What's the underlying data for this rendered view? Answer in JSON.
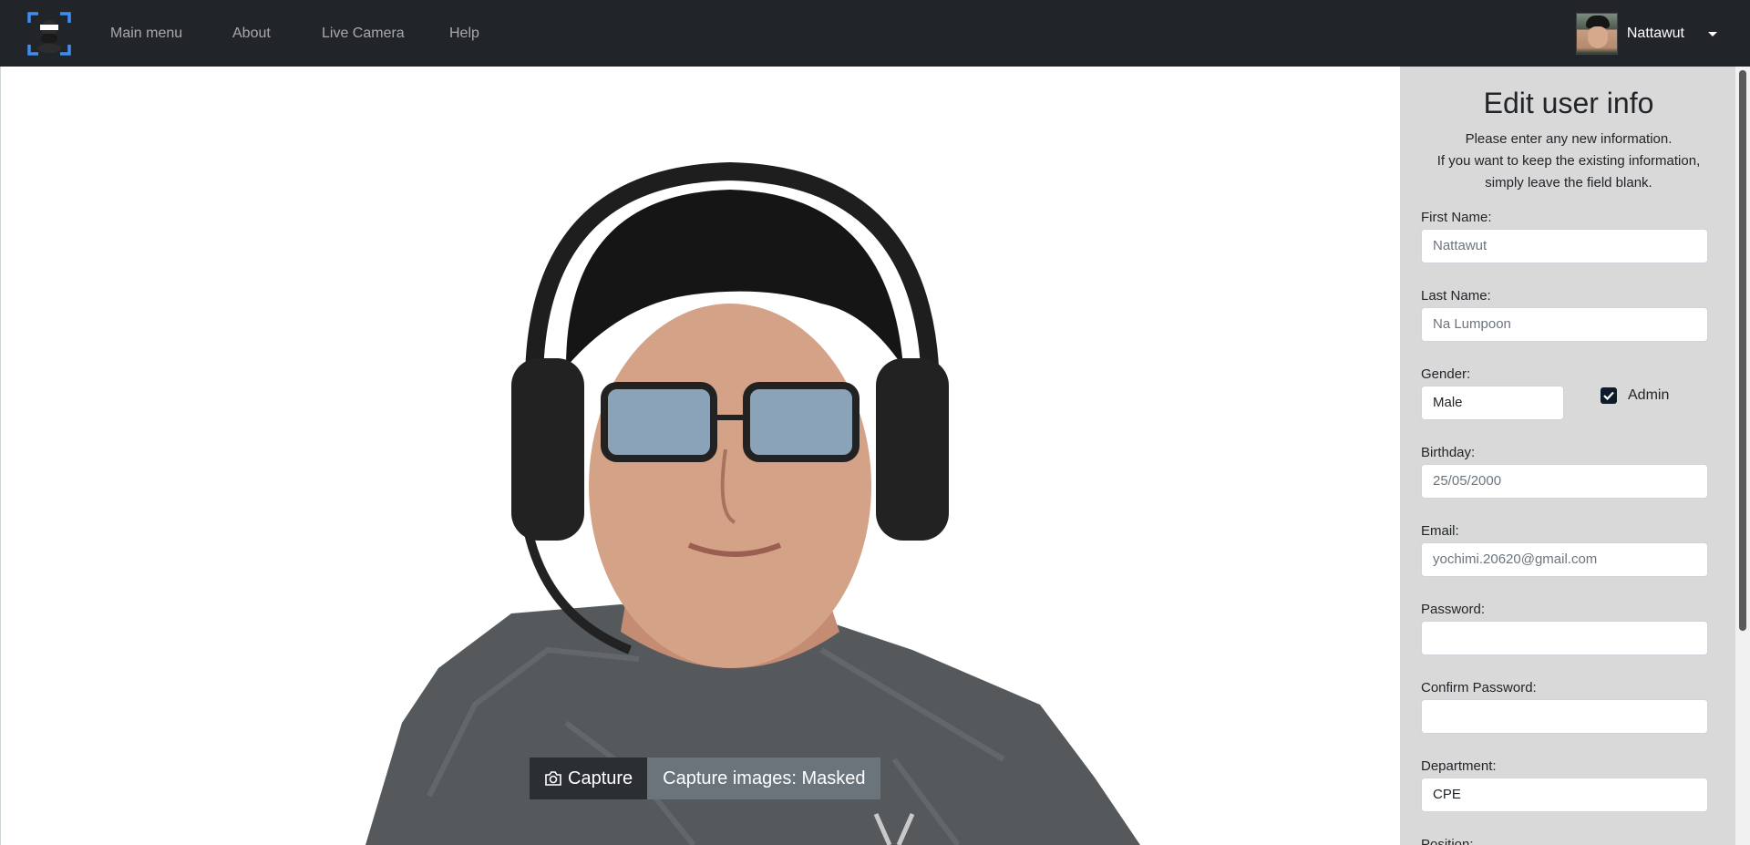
{
  "nav": {
    "links": [
      "Main menu",
      "About",
      "Live Camera",
      "Help"
    ],
    "username": "Nattawut"
  },
  "camera": {
    "capture_label": "Capture",
    "mode_label": "Capture images: Masked"
  },
  "form": {
    "title": "Edit user info",
    "description": [
      "Please enter any new information.",
      "If you want to keep the existing information,",
      "simply leave the field blank."
    ],
    "first_name": {
      "label": "First Name:",
      "placeholder": "Nattawut"
    },
    "last_name": {
      "label": "Last Name:",
      "placeholder": "Na Lumpoon"
    },
    "gender": {
      "label": "Gender:",
      "value": "Male"
    },
    "admin": {
      "label": "Admin",
      "checked": true
    },
    "birthday": {
      "label": "Birthday:",
      "placeholder": "25/05/2000"
    },
    "email": {
      "label": "Email:",
      "placeholder": "yochimi.20620@gmail.com"
    },
    "password": {
      "label": "Password:",
      "placeholder": ""
    },
    "confirm_password": {
      "label": "Confirm Password:",
      "placeholder": ""
    },
    "department": {
      "label": "Department:",
      "value": "CPE"
    },
    "position": {
      "label": "Position:"
    }
  },
  "colors": {
    "navbar": "#212529",
    "panel": "#d9d9d9",
    "logo_accent": "#3d8df2"
  }
}
